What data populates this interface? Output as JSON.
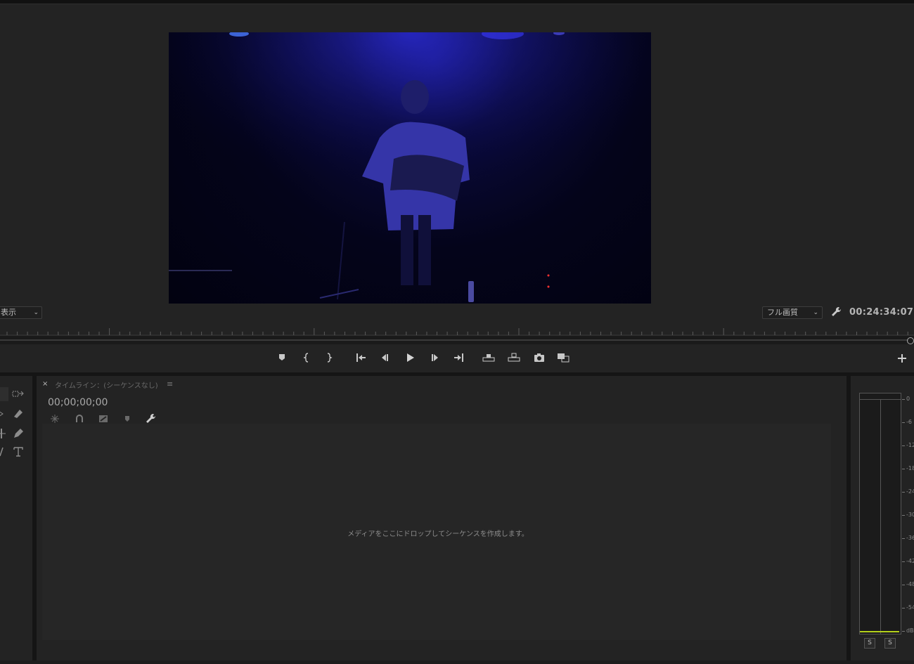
{
  "monitor": {
    "fit_label": "表示",
    "quality_label": "フル画質",
    "timecode": "00:24:34:07",
    "add_button": "+"
  },
  "timeline": {
    "close": "×",
    "title": "タイムライン：(シーケンスなし)",
    "menu": "≡",
    "timecode": "00;00;00;00",
    "placeholder": "メディアをここにドロップしてシーケンスを作成します。"
  },
  "meter": {
    "scale": [
      "0",
      "-6",
      "-12",
      "-18",
      "-24",
      "-30",
      "-36",
      "-42",
      "-48",
      "-54",
      "dB"
    ],
    "solo_left": "S",
    "solo_right": "S"
  },
  "icons": {
    "transport": [
      "marker-icon",
      "mark-in-icon",
      "mark-out-icon",
      "go-to-in-icon",
      "step-back-icon",
      "play-icon",
      "step-forward-icon",
      "go-to-out-icon",
      "lift-icon",
      "extract-icon",
      "export-frame-icon",
      "comparison-view-icon"
    ],
    "timeline": [
      "snap-icon",
      "linked-selection-icon",
      "add-marker-icon",
      "marker-icon",
      "settings-wrench-icon"
    ],
    "tools": [
      "selection-tool-icon",
      "track-select-icon",
      "ripple-edit-icon",
      "razor-icon",
      "slip-icon",
      "pen-icon",
      "hand-icon",
      "type-tool-icon"
    ]
  },
  "colors": {
    "panel_bg": "#232323",
    "meter_level": "#b4d11a"
  }
}
